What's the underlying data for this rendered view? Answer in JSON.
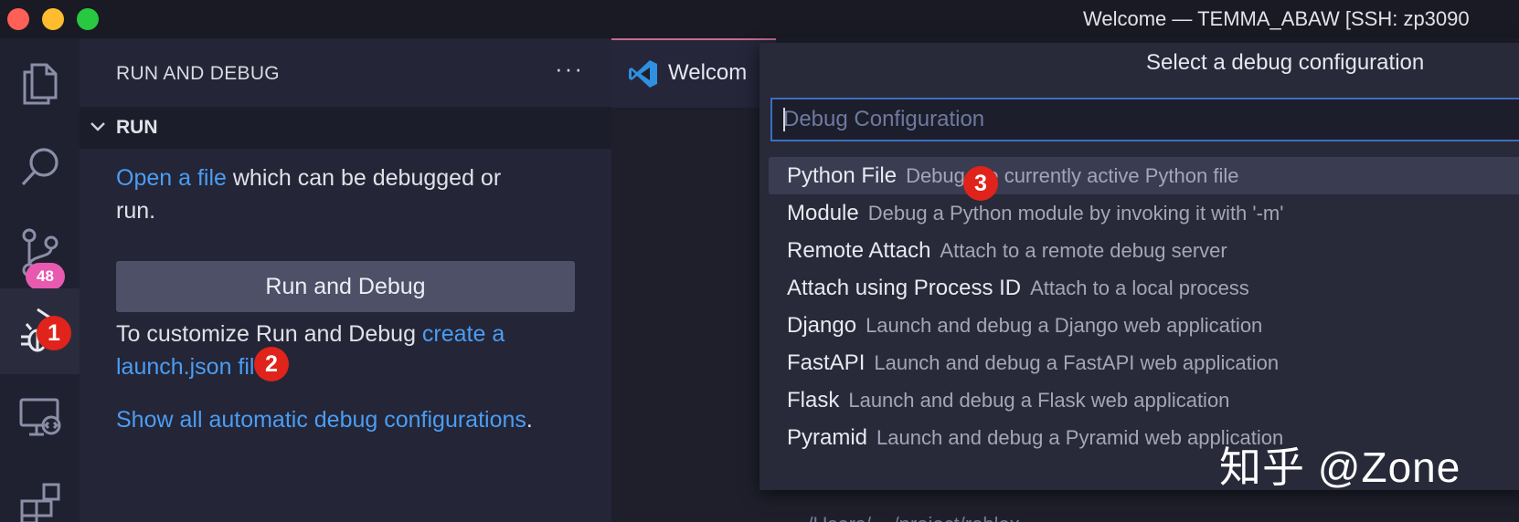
{
  "window": {
    "title": "Welcome — TEMMA_ABAW [SSH: zp3090"
  },
  "activity_bar": {
    "items": [
      {
        "icon": "files-icon"
      },
      {
        "icon": "search-icon"
      },
      {
        "icon": "source-control-icon",
        "badge": "48"
      },
      {
        "icon": "run-debug-icon",
        "active": true
      },
      {
        "icon": "remote-explorer-icon"
      },
      {
        "icon": "extensions-icon"
      }
    ]
  },
  "annotations": {
    "marker1": "1",
    "marker2": "2",
    "marker3": "3"
  },
  "sidebar": {
    "title": "RUN AND DEBUG",
    "more": "···",
    "section": "RUN",
    "open_file_link": "Open a file",
    "open_file_rest_1": " which can be debugged or",
    "open_file_rest_2": "run.",
    "run_button": "Run and Debug",
    "customize_text": "To customize Run and Debug ",
    "create_link_1": "create a",
    "create_link_2": "launch.json fil",
    "show_all_link": "Show all automatic debug configurations",
    "show_all_period": "."
  },
  "editor": {
    "tab_label": "Welcom",
    "tab_icon": "vscode-icon",
    "bottom_text": "... /Users/... /project/roblox"
  },
  "quick_pick": {
    "title": "Select a debug configuration",
    "placeholder": "Debug Configuration",
    "items": [
      {
        "label": "Python File",
        "description": "Debug the currently active Python file",
        "selected": true
      },
      {
        "label": "Module",
        "description": "Debug a Python module by invoking it with '-m'"
      },
      {
        "label": "Remote Attach",
        "description": "Attach to a remote debug server"
      },
      {
        "label": "Attach using Process ID",
        "description": "Attach to a local process"
      },
      {
        "label": "Django",
        "description": "Launch and debug a Django web application"
      },
      {
        "label": "FastAPI",
        "description": "Launch and debug a FastAPI web application"
      },
      {
        "label": "Flask",
        "description": "Launch and debug a Flask web application"
      },
      {
        "label": "Pyramid",
        "description": "Launch and debug a Pyramid web application"
      }
    ]
  },
  "watermark": "知乎 @Zone",
  "colors": {
    "accent_link": "#4a9df5",
    "badge": "#e85ab0",
    "marker": "#e0231b",
    "focus_border": "#3d6fbf"
  }
}
